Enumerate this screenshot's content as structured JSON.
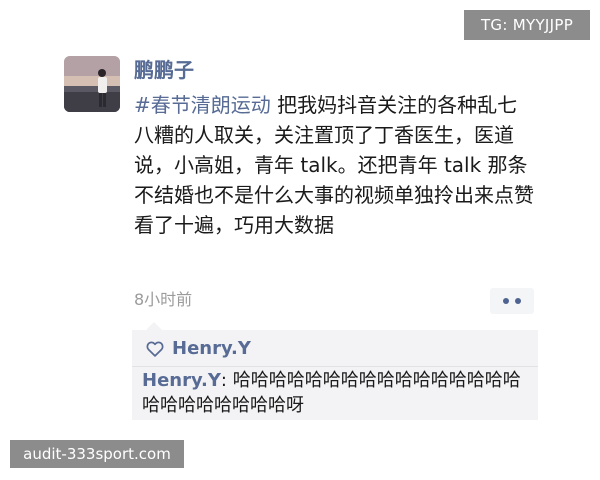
{
  "watermark_top": "TG: MYYJJPP",
  "watermark_bottom": "audit-333sport.com",
  "post": {
    "author": "鹏鹏子",
    "topic": "#春节清朗运动",
    "body": " 把我妈抖音关注的各种乱七八糟的人取关，关注置顶了丁香医生，医道说，小高姐，青年 talk。还把青年 talk 那条不结婚也不是什么大事的视频单独拎出来点赞看了十遍，巧用大数据",
    "time": "8小时前"
  },
  "likes": {
    "icon": "heart-icon",
    "names": "Henry.Y"
  },
  "comment": {
    "author": "Henry.Y",
    "separator": ": ",
    "text": "哈哈哈哈哈哈哈哈哈哈哈哈哈哈哈哈哈哈哈哈哈哈哈哈呀"
  },
  "colors": {
    "link": "#576b95",
    "text": "#1a1a1a",
    "muted": "#9b9b9b",
    "comment_bg": "#f3f3f5",
    "watermark_bg": "#8c8c8c"
  }
}
